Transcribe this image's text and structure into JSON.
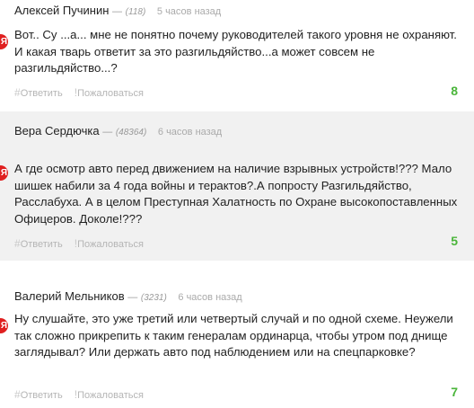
{
  "comments": [
    {
      "author": "Алексей Пучинин",
      "karma": "(118)",
      "time": "5 часов назад",
      "text": "Вот.. Су ...а... мне не понятно почему руководителей такого уровня не охраняют. И какая тварь ответит за это разгильдяйство...а может совсем не разгильдяйство...?",
      "reply": "Ответить",
      "report": "Пожаловаться",
      "score": "8"
    },
    {
      "author": "Вера Сердючка",
      "karma": "(48364)",
      "time": "6 часов назад",
      "text": "А где осмотр авто перед движением на наличие взрывных устройств!??? Мало шишек набили за 4 года войны и терактов?.А  попросту Разгильдяйство, Расслабуха.  А в целом  Преступная Халатность по Охране высокопоставленных Офицеров. Доколе!???",
      "reply": "Ответить",
      "report": "Пожаловаться",
      "score": "5"
    },
    {
      "author": "Валерий Мельников",
      "karma": "(3231)",
      "time": "6 часов назад",
      "text": "Ну слушайте, это уже третий или четвертый случай и по одной схеме. Неужели так сложно прикрепить к таким генералам ординарца, чтобы утром под днище заглядывал? Или держать авто под наблюдением или на спецпарковке?",
      "reply": "Ответить",
      "report": "Пожаловаться",
      "score": "7"
    }
  ],
  "icons": {
    "source": "yandex-icon",
    "reply": "hash-icon",
    "report": "exclamation-icon"
  },
  "colors": {
    "score": "#4ab53a",
    "source_badge": "#e02020",
    "alt_background": "#f1f1f1"
  }
}
